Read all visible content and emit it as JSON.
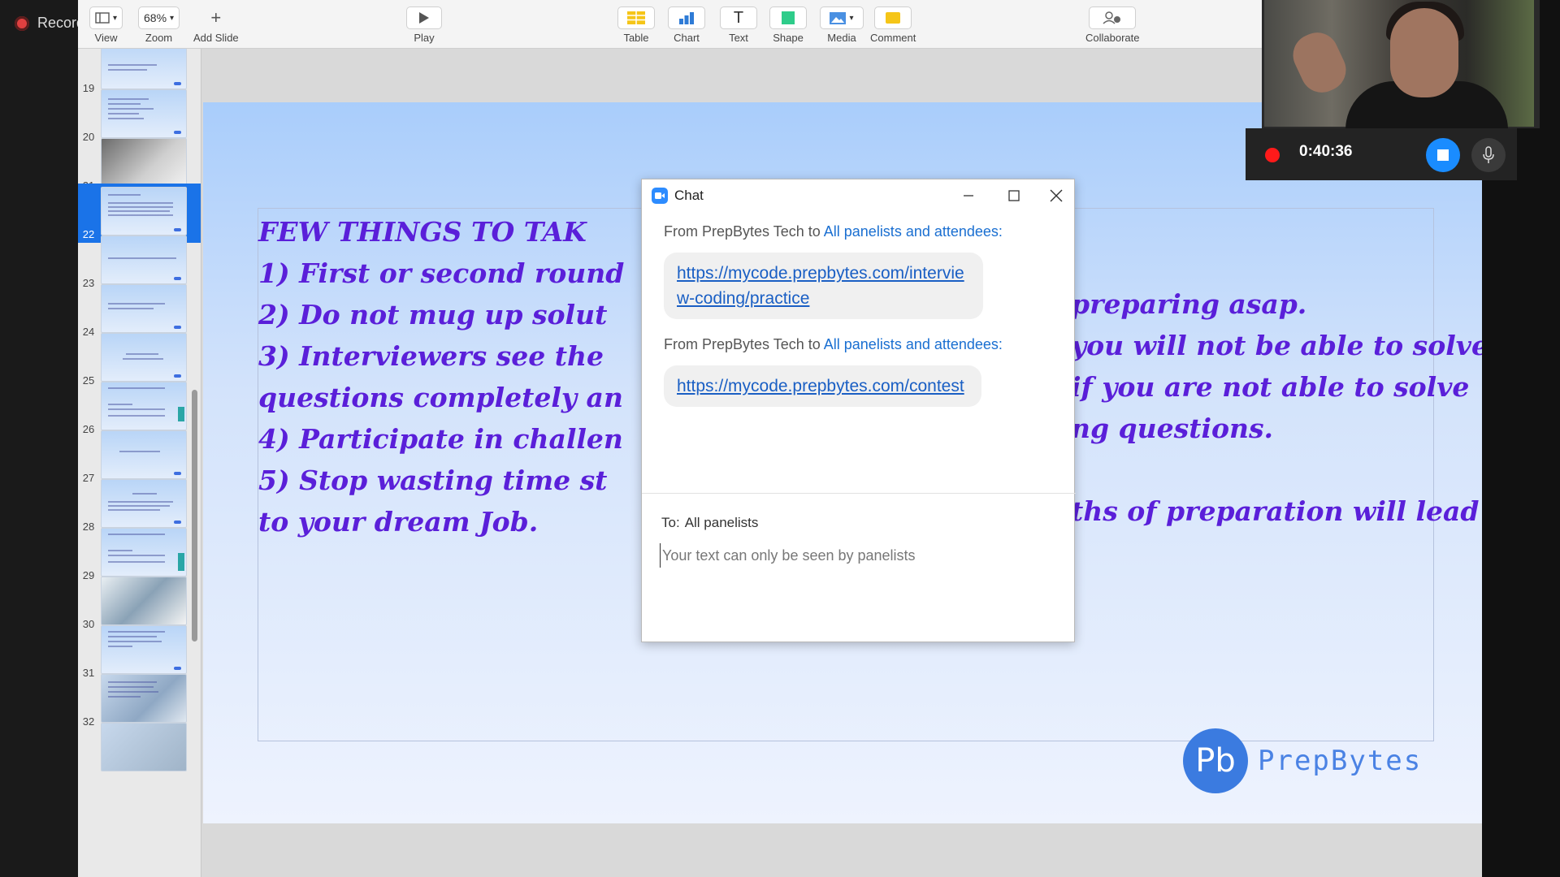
{
  "recording": {
    "label": "Recording"
  },
  "toolbar": {
    "view_label": "View",
    "zoom_label": "Zoom",
    "zoom_value": "68%",
    "add_slide_label": "Add Slide",
    "play_label": "Play",
    "table_label": "Table",
    "chart_label": "Chart",
    "text_label": "Text",
    "shape_label": "Shape",
    "media_label": "Media",
    "comment_label": "Comment",
    "collaborate_label": "Collaborate"
  },
  "sidebar": {
    "selected": "22",
    "slides": [
      "19",
      "20",
      "21",
      "22",
      "23",
      "24",
      "25",
      "26",
      "27",
      "28",
      "29",
      "30",
      "31",
      "32"
    ]
  },
  "slide": {
    "title": "FEW THINGS TO TAK",
    "lines": [
      "1) First or second round",
      "2) Do not mug up solut",
      "3) Interviewers see the",
      "questions completely an",
      "4) Participate in challen",
      "5) Stop wasting time st",
      "to your dream Job."
    ],
    "lines_right": [
      "preparing asap.",
      "you will not be able to solve it",
      "if you are not able to solve",
      "ng questions.",
      "",
      "ths of preparation will lead you",
      ""
    ],
    "logo_mark": "Pb",
    "logo_text": "PrepBytes"
  },
  "chat": {
    "title": "Chat",
    "messages": [
      {
        "from": "From PrepBytes Tech to",
        "to": "All panelists and attendees:",
        "text": "https://mycode.prepbytes.com/interview-coding/practice"
      },
      {
        "from": "From PrepBytes Tech to",
        "to": "All panelists and attendees:",
        "text": "https://mycode.prepbytes.com/contest"
      }
    ],
    "to_label": "To:",
    "to_value": "All panelists",
    "input_placeholder": "Your text can only be seen by panelists"
  },
  "meeting": {
    "timer": "0:40:36"
  },
  "colors": {
    "slide_text": "#5a1fd9",
    "accent": "#1a73e8",
    "record_red": "#ff1a1a",
    "stop_blue": "#1a8cff"
  }
}
